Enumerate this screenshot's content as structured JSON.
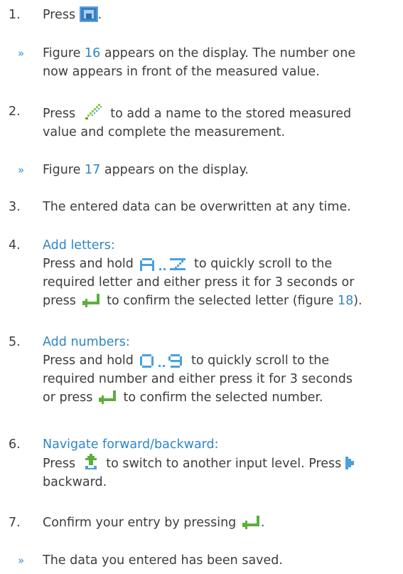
{
  "steps": {
    "s1": {
      "num": "1.",
      "text_before": "Press",
      "text_after": "."
    },
    "r1": {
      "bullet": "»",
      "pre": "Figure ",
      "fig": "16",
      "post": " appears on the display. The number one",
      "line2": "now appears in front of the measured value."
    },
    "s2": {
      "num": "2.",
      "pre": "Press",
      "post": "to add a name to the stored measured",
      "line2": "value and complete the measurement."
    },
    "r2": {
      "bullet": "»",
      "pre": "Figure ",
      "fig": "17",
      "post": " appears on the display."
    },
    "s3": {
      "num": "3.",
      "text": "The entered data can be overwritten at any time."
    },
    "s4": {
      "num": "4.",
      "heading": "Add letters:",
      "l1_pre": "Press and hold",
      "l1_post": "to quickly scroll to the",
      "l2": "required letter and either press it for 3 seconds or",
      "l3_pre": "press",
      "l3_mid": "to confirm the selected letter (figure ",
      "l3_fig": "18",
      "l3_post": ")."
    },
    "s5": {
      "num": "5.",
      "heading": "Add numbers:",
      "l1_pre": "Press and hold",
      "l1_post": "to quickly scroll to the",
      "l2": "required number and either press it for 3 seconds",
      "l3_pre": "or press",
      "l3_post": "to confirm the selected number."
    },
    "s6": {
      "num": "6.",
      "heading": "Navigate forward/backward:",
      "l1_pre": "Press",
      "l1_mid": "to switch to another input level. Press",
      "l2": "backward."
    },
    "s7": {
      "num": "7.",
      "pre": "Confirm your entry by pressing",
      "post": "."
    },
    "r3": {
      "bullet": "»",
      "text": "The data you entered has been saved."
    }
  },
  "icons": {
    "store": "store-icon",
    "pencil": "pencil-icon",
    "az": "a-to-z-icon",
    "enter": "enter-icon",
    "zero_nine": "zero-to-nine-icon",
    "shift": "shift-up-icon",
    "back": "back-icon"
  },
  "colors": {
    "text": "#3d3d3d",
    "accent": "#2f86c7"
  }
}
